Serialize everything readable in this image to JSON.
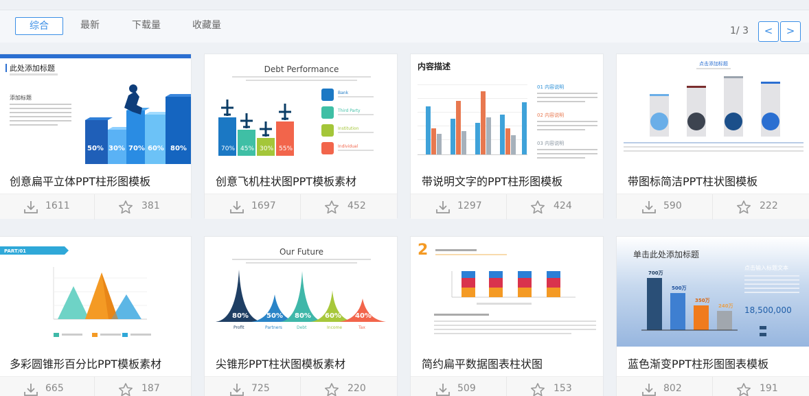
{
  "sort_tabs": [
    "综合",
    "最新",
    "下载量",
    "收藏量"
  ],
  "pager": {
    "text": "1/ 3",
    "prev": "<",
    "next": ">"
  },
  "cards": [
    {
      "title": "创意扁平立体PPT柱形图模板",
      "downloads": "1611",
      "favorites": "381",
      "thumb": {
        "heading": "此处添加标题",
        "subheading": "添加标题",
        "values": [
          "50%",
          "30%",
          "70%",
          "60%",
          "80%"
        ]
      }
    },
    {
      "title": "创意飞机柱状图PPT模板素材",
      "downloads": "1697",
      "favorites": "452",
      "thumb": {
        "heading": "Debt Performance",
        "values": [
          "70%",
          "45%",
          "30%",
          "55%"
        ],
        "legend": [
          "Bank",
          "Third Party",
          "Institution",
          "Individual"
        ]
      }
    },
    {
      "title": "带说明文字的PPT柱形图模板",
      "downloads": "1297",
      "favorites": "424",
      "thumb": {
        "heading": "内容描述",
        "items": [
          "01 内容说明",
          "02 内容说明",
          "03 内容说明"
        ]
      }
    },
    {
      "title": "带图标简洁PPT柱状图模板",
      "downloads": "590",
      "favorites": "222",
      "thumb": {
        "heading": "点击添加标题"
      }
    },
    {
      "title": "多彩圆锥形百分比PPT模板素材",
      "downloads": "665",
      "favorites": "187",
      "thumb": {
        "tag": "PART/01"
      }
    },
    {
      "title": "尖锥形PPT柱状图模板素材",
      "downloads": "725",
      "favorites": "220",
      "thumb": {
        "heading": "Our Future",
        "values": [
          "80%",
          "50%",
          "80%",
          "60%",
          "40%"
        ],
        "labels": [
          "Profit",
          "Partners",
          "Debt",
          "Income",
          "Tax"
        ]
      }
    },
    {
      "title": "简约扁平数据图表柱状图",
      "downloads": "509",
      "favorites": "153",
      "thumb": {
        "number": "2"
      }
    },
    {
      "title": "蓝色渐变PPT柱形图图表模板",
      "downloads": "802",
      "favorites": "191",
      "thumb": {
        "heading": "单击此处添加标题",
        "side_title": "点击输入标题文本",
        "big_number": "18,500,000",
        "bar_labels": [
          "700万",
          "500万",
          "350万",
          "240万"
        ]
      }
    }
  ],
  "colors": {
    "accent": "#3a8ee6",
    "text": "#222222",
    "muted": "#888888"
  },
  "icons": {
    "download": "download-icon",
    "favorite": "star-icon"
  }
}
